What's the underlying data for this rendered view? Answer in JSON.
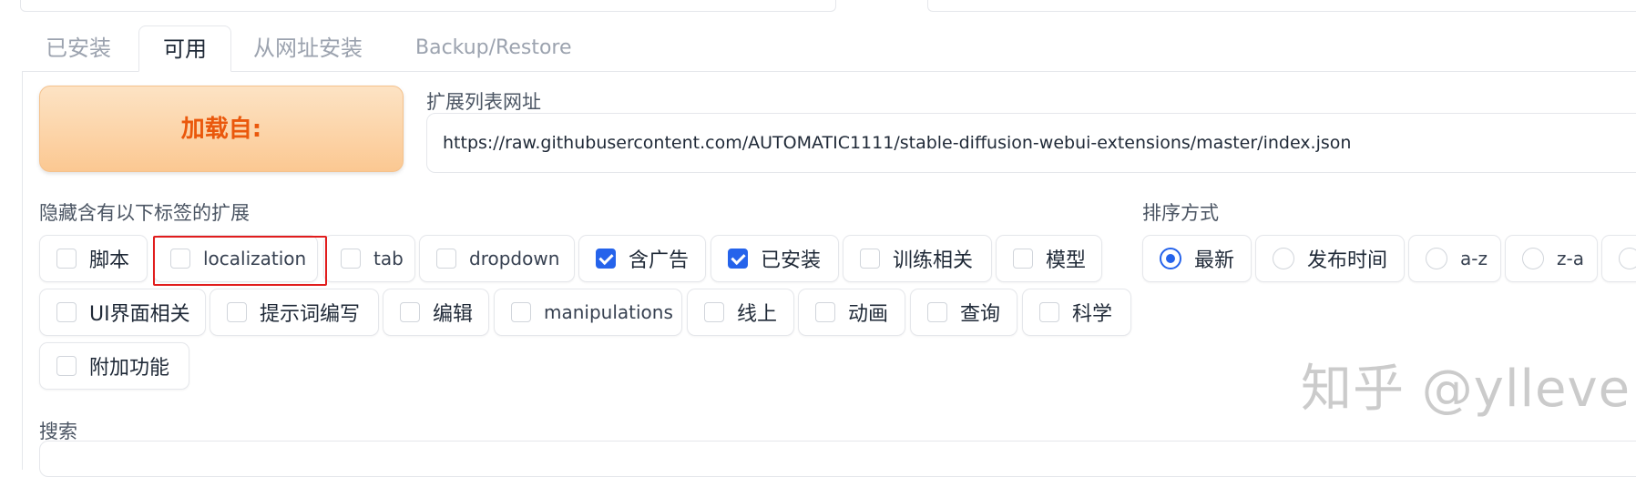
{
  "tabs": [
    {
      "label": "已安装",
      "active": false
    },
    {
      "label": "可用",
      "active": true
    },
    {
      "label": "从网址安装",
      "active": false
    },
    {
      "label": "Backup/Restore",
      "active": false
    }
  ],
  "load_button": {
    "label": "加载自:"
  },
  "url_field": {
    "label": "扩展列表网址",
    "value": "https://raw.githubusercontent.com/AUTOMATIC1111/stable-diffusion-webui-extensions/master/index.json"
  },
  "hide_tags": {
    "label": "隐藏含有以下标签的扩展",
    "items": [
      {
        "label": "脚本",
        "checked": false
      },
      {
        "label": "localization",
        "checked": false
      },
      {
        "label": "tab",
        "checked": false
      },
      {
        "label": "dropdown",
        "checked": false
      },
      {
        "label": "含广告",
        "checked": true
      },
      {
        "label": "已安装",
        "checked": true
      },
      {
        "label": "训练相关",
        "checked": false
      },
      {
        "label": "模型",
        "checked": false
      },
      {
        "label": "UI界面相关",
        "checked": false
      },
      {
        "label": "提示词编写",
        "checked": false
      },
      {
        "label": "编辑",
        "checked": false
      },
      {
        "label": "manipulations",
        "checked": false
      },
      {
        "label": "线上",
        "checked": false
      },
      {
        "label": "动画",
        "checked": false
      },
      {
        "label": "查询",
        "checked": false
      },
      {
        "label": "科学",
        "checked": false
      },
      {
        "label": "附加功能",
        "checked": false
      }
    ]
  },
  "sort": {
    "label": "排序方式",
    "options": [
      {
        "label": "最新",
        "selected": true
      },
      {
        "label": "发布时间",
        "selected": false
      },
      {
        "label": "a-z",
        "selected": false
      },
      {
        "label": "z-a",
        "selected": false
      },
      {
        "label": "",
        "selected": false
      }
    ]
  },
  "search": {
    "label": "搜索",
    "value": ""
  },
  "watermark": {
    "text": "知乎 @ylleve"
  },
  "colors": {
    "accent": "#2563eb",
    "load_button_text": "#ea580c",
    "highlight": "#e11d1d"
  }
}
